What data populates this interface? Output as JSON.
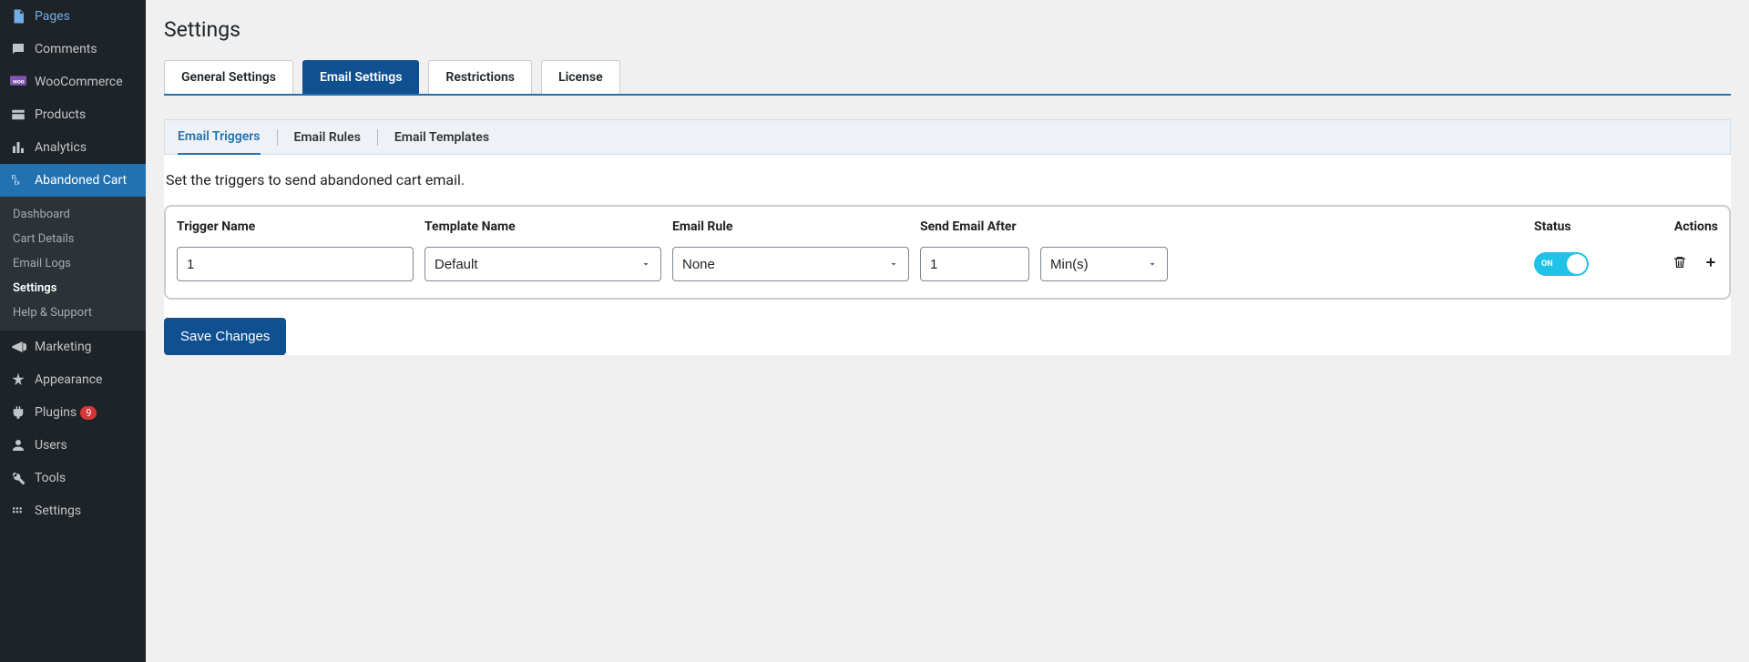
{
  "sidebar": {
    "items": [
      {
        "label": "Pages",
        "icon": "page"
      },
      {
        "label": "Comments",
        "icon": "comment"
      },
      {
        "label": "WooCommerce",
        "icon": "woo"
      },
      {
        "label": "Products",
        "icon": "products"
      },
      {
        "label": "Analytics",
        "icon": "analytics"
      },
      {
        "label": "Abandoned Cart",
        "icon": "cart",
        "active": true
      },
      {
        "label": "Marketing",
        "icon": "marketing"
      },
      {
        "label": "Appearance",
        "icon": "appearance"
      },
      {
        "label": "Plugins",
        "icon": "plugins",
        "badge": "9"
      },
      {
        "label": "Users",
        "icon": "users"
      },
      {
        "label": "Tools",
        "icon": "tools"
      },
      {
        "label": "Settings",
        "icon": "settings"
      }
    ],
    "submenu": [
      {
        "label": "Dashboard"
      },
      {
        "label": "Cart Details"
      },
      {
        "label": "Email Logs"
      },
      {
        "label": "Settings",
        "active": true
      },
      {
        "label": "Help & Support"
      }
    ]
  },
  "page": {
    "title": "Settings",
    "tabs": [
      {
        "label": "General Settings"
      },
      {
        "label": "Email Settings",
        "active": true
      },
      {
        "label": "Restrictions"
      },
      {
        "label": "License"
      }
    ],
    "subtabs": [
      {
        "label": "Email Triggers",
        "active": true
      },
      {
        "label": "Email Rules"
      },
      {
        "label": "Email Templates"
      }
    ],
    "description": "Set the triggers to send abandoned cart email.",
    "table": {
      "headers": {
        "trigger_name": "Trigger Name",
        "template_name": "Template Name",
        "email_rule": "Email Rule",
        "send_after": "Send Email After",
        "status": "Status",
        "actions": "Actions"
      },
      "row": {
        "trigger_name": "1",
        "template_name": "Default",
        "email_rule": "None",
        "send_after_value": "1",
        "send_after_unit": "Min(s)",
        "status": "ON"
      }
    },
    "save_label": "Save Changes"
  }
}
